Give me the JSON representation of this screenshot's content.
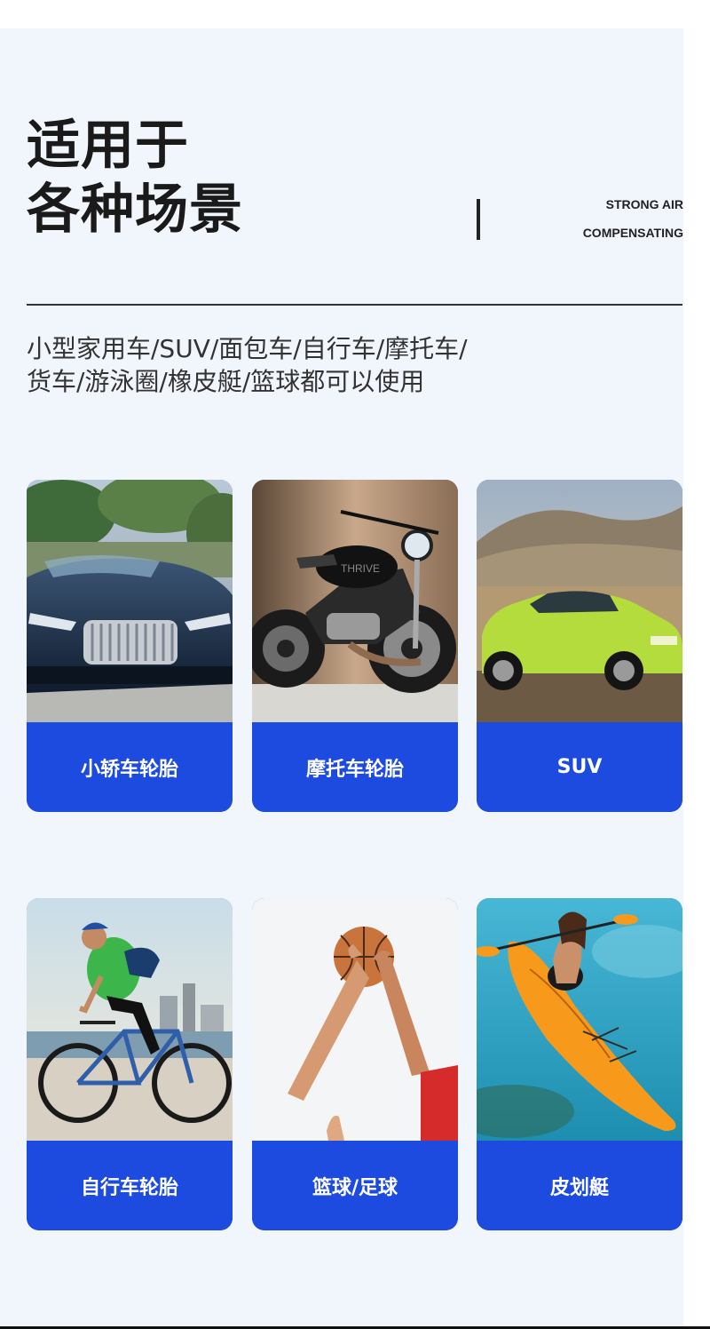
{
  "header": {
    "title_line1": "适用于",
    "title_line2": "各种场景",
    "subtitle_en_line1": "STRONG AIR",
    "subtitle_en_line2": "COMPENSATING"
  },
  "description": {
    "line1": "小型家用车/SUV/面包车/自行车/摩托车/",
    "line2": "货车/游泳圈/橡皮艇/篮球都可以使用"
  },
  "cards": [
    {
      "label": "小轿车轮胎",
      "icon": "car-photo"
    },
    {
      "label": "摩托车轮胎",
      "icon": "motorcycle-photo"
    },
    {
      "label": "SUV",
      "icon": "suv-photo"
    },
    {
      "label": "自行车轮胎",
      "icon": "bicycle-photo"
    },
    {
      "label": "篮球/足球",
      "icon": "basketball-photo"
    },
    {
      "label": "皮划艇",
      "icon": "kayak-photo"
    }
  ],
  "colors": {
    "accent": "#1e4bdf",
    "background": "#f1f5fc",
    "text": "#1a1a1a"
  }
}
